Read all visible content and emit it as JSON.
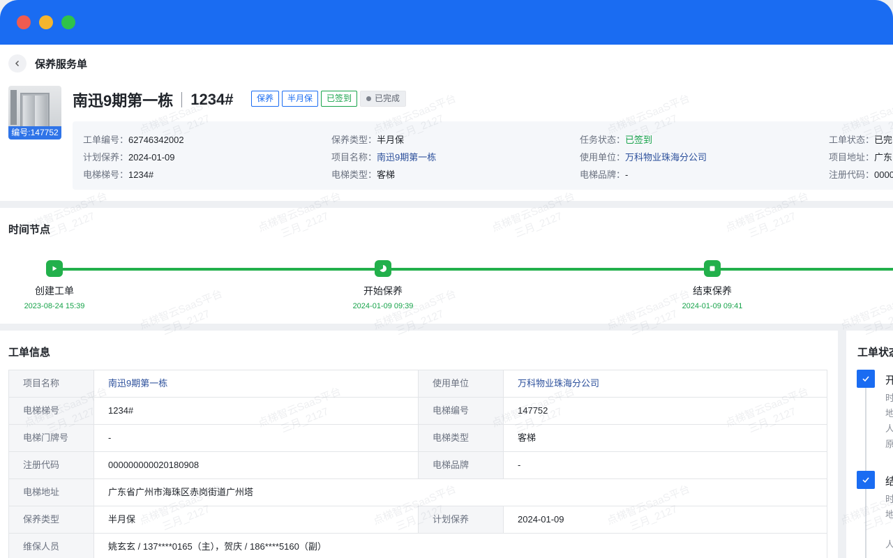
{
  "page": {
    "title": "保养服务单"
  },
  "header": {
    "thumb_badge": "编号:147752",
    "elevator_name": "南迅9期第一栋",
    "elevator_no": "1234#",
    "tags": [
      "保养",
      "半月保",
      "已签到"
    ],
    "status": "已完成"
  },
  "info": {
    "col1": [
      {
        "k": "工单编号：",
        "v": "62746342002"
      },
      {
        "k": "计划保养：",
        "v": "2024-01-09"
      },
      {
        "k": "电梯梯号：",
        "v": "1234#"
      }
    ],
    "col2": [
      {
        "k": "保养类型：",
        "v": "半月保"
      },
      {
        "k": "项目名称：",
        "v": "南迅9期第一栋"
      },
      {
        "k": "电梯类型：",
        "v": "客梯"
      }
    ],
    "col3": [
      {
        "k": "任务状态：",
        "v": "已签到"
      },
      {
        "k": "使用单位：",
        "v": "万科物业珠海分公司"
      },
      {
        "k": "电梯品牌：",
        "v": "-"
      }
    ],
    "col4": [
      {
        "k": "工单状态：",
        "v": "已完"
      },
      {
        "k": "项目地址：",
        "v": "广东"
      },
      {
        "k": "注册代码：",
        "v": "0000"
      }
    ]
  },
  "timeline": {
    "title": "时间节点",
    "nodes": [
      {
        "label": "创建工单",
        "time": "2023-08-24 15:39"
      },
      {
        "label": "开始保养",
        "time": "2024-01-09 09:39"
      },
      {
        "label": "结束保养",
        "time": "2024-01-09 09:41"
      }
    ]
  },
  "order": {
    "title": "工单信息",
    "rows": [
      {
        "k1": "项目名称",
        "v1": "南迅9期第一栋",
        "k2": "使用单位",
        "v2": "万科物业珠海分公司"
      },
      {
        "k1": "电梯梯号",
        "v1": "1234#",
        "k2": "电梯编号",
        "v2": "147752"
      },
      {
        "k1": "电梯门牌号",
        "v1": "-",
        "k2": "电梯类型",
        "v2": "客梯"
      },
      {
        "k1": "注册代码",
        "v1": "000000000020180908",
        "k2": "电梯品牌",
        "v2": "-"
      },
      {
        "k1": "电梯地址",
        "v1": "广东省广州市海珠区赤岗街道广州塔"
      },
      {
        "k1": "保养类型",
        "v1": "半月保",
        "k2": "计划保养",
        "v2": "2024-01-09"
      },
      {
        "k1": "维保人员",
        "v1": "姚玄玄 / 137****0165（主），贺庆 / 186****5160（副）"
      }
    ]
  },
  "status_panel": {
    "title": "工单状态",
    "steps": [
      {
        "name": "开",
        "lines": [
          "时",
          "地",
          "人",
          "原"
        ]
      },
      {
        "name": "结",
        "lines": [
          "时",
          "地",
          "人"
        ]
      }
    ]
  },
  "watermark": {
    "line1": "点梯智云SaaS平台",
    "line2": "三月_2127"
  },
  "colors": {
    "titlebar": "#1a6cf2",
    "accent": "#1a6cf2",
    "success": "#22b04b"
  }
}
